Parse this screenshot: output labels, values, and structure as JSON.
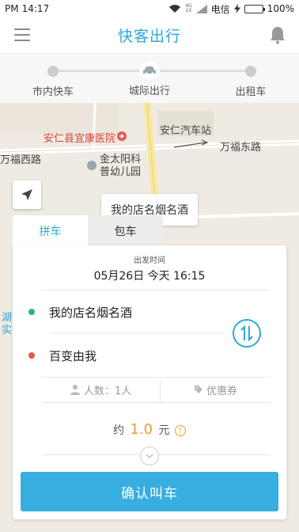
{
  "status_bar": {
    "period": "PM",
    "time": "14:17",
    "signal_a": "4G",
    "signal_b": "1X",
    "carrier": "电信",
    "battery": "100%",
    "battery_level": 1.0
  },
  "header": {
    "title": "快客出行",
    "icons": {
      "menu": "menu-icon",
      "notification": "bell-icon"
    }
  },
  "service_tabs": [
    {
      "label": "市内快车"
    },
    {
      "label": "城际出行",
      "active": true
    },
    {
      "label": "出租车"
    }
  ],
  "map": {
    "labels": {
      "hospital": "安仁县宜康医院",
      "station": "安仁汽车站",
      "road_west": "万福西路",
      "road_east": "万福东路",
      "kindergarten_line1": "金太阳科",
      "kindergarten_line2": "普幼儿园",
      "lake_line1": "湖",
      "lake_line2": "实"
    },
    "pin_label": "我的店名烟名酒"
  },
  "order_card": {
    "tabs": [
      {
        "label": "拼车",
        "active": true
      },
      {
        "label": "包车"
      }
    ],
    "departure_label": "出发时间",
    "departure_time": "05月26日 今天 16:15",
    "origin": "我的店名烟名酒",
    "destination": "百变由我",
    "passengers_label": "人数：1人",
    "coupon_label": "优惠券",
    "price_prefix": "约",
    "price_value": "1.0",
    "price_unit": "元",
    "info_mark": "!",
    "confirm_label": "确认叫车"
  },
  "colors": {
    "accent": "#2ea8d6",
    "confirm_button": "#38aee0",
    "origin_dot": "#2db67c",
    "destination_dot": "#e85353",
    "price": "#f09a2b"
  }
}
